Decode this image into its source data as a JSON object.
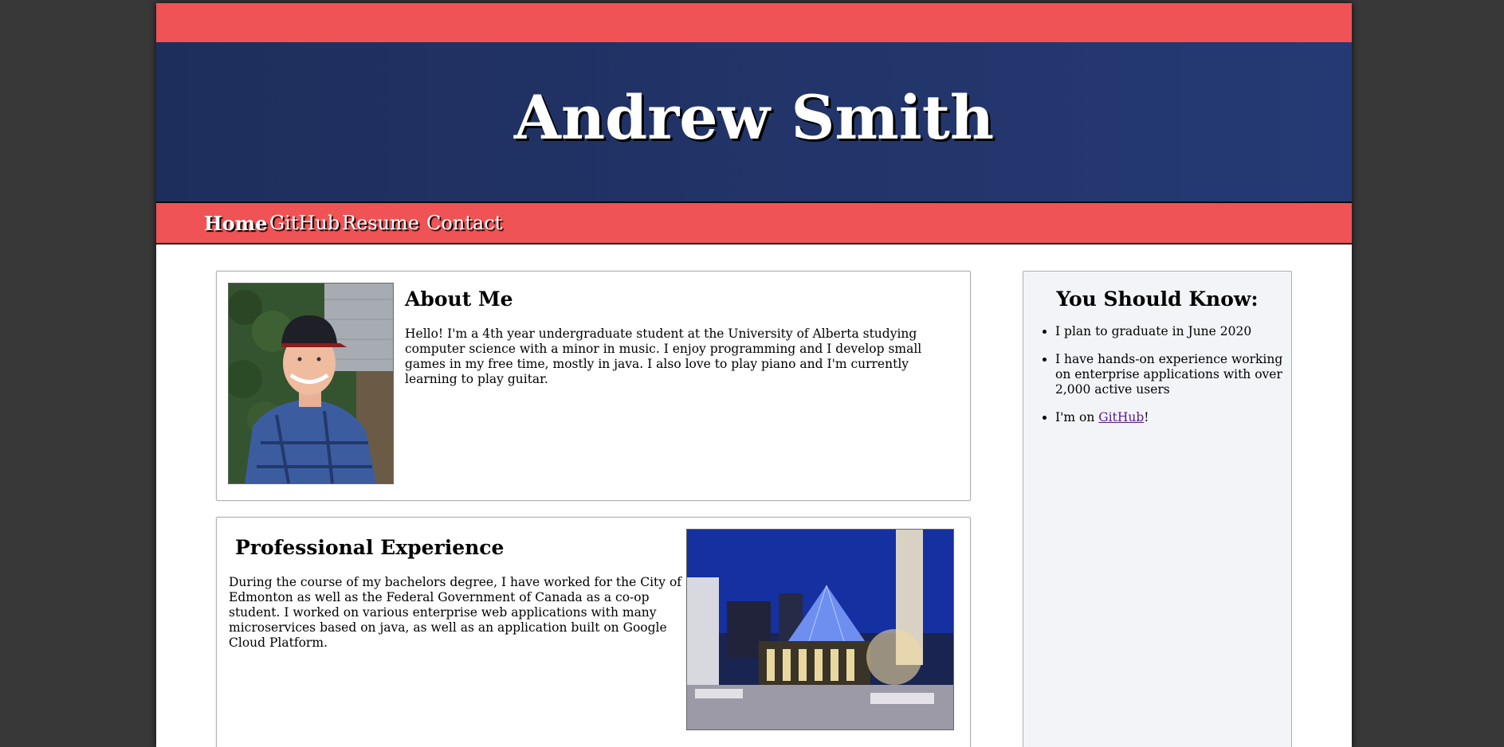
{
  "header": {
    "title": "Andrew Smith"
  },
  "nav": {
    "items": [
      {
        "label": "Home"
      },
      {
        "label": "GitHub"
      },
      {
        "label": "Resume"
      },
      {
        "label": "Contact"
      }
    ]
  },
  "about": {
    "title": "About Me",
    "text": "Hello! I'm a 4th year undergraduate student at the University of Alberta studying computer science with a minor in music. I enjoy programming and I develop small games in my free time, mostly in java. I also love to play piano and I'm currently learning to play guitar."
  },
  "experience": {
    "title": "Professional Experience",
    "text": "During the course of my bachelors degree, I have worked for the City of Edmonton as well as the Federal Government of Canada as a co-op student. I worked on various enterprise web applications with many microservices based on java, as well as an application built on Google Cloud Platform."
  },
  "aside": {
    "title": "You Should Know:",
    "items": [
      {
        "text": "I plan to graduate in June 2020"
      },
      {
        "text": "I have hands-on experience working on enterprise applications with over 2,000 active users"
      }
    ],
    "github_prefix": "I'm on ",
    "github_link": "GitHub",
    "github_suffix": "!"
  },
  "colors": {
    "accent_red": "#ef5355",
    "header_navy": "#1f3060",
    "background": "#383838",
    "aside_bg": "#f3f4f8"
  }
}
